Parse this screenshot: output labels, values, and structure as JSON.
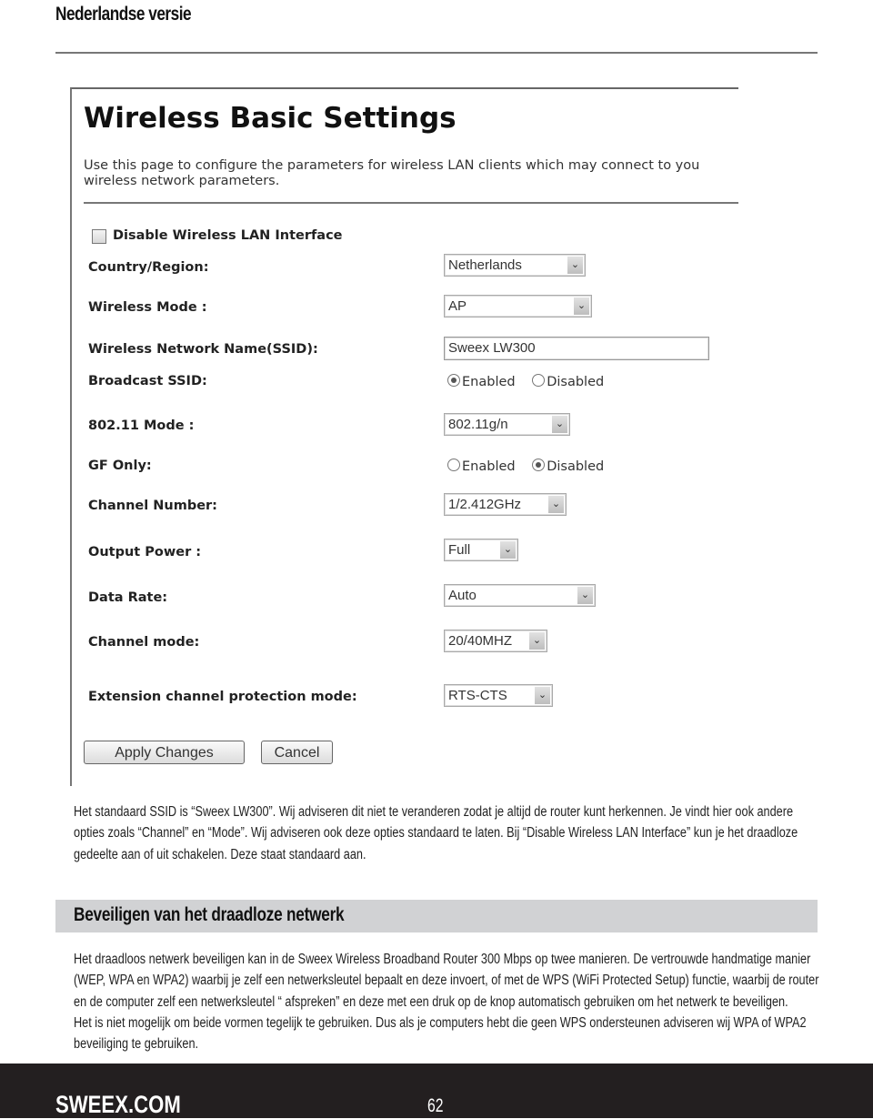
{
  "page": {
    "header": "Nederlandse versie",
    "footer_brand": "SWEEX.COM",
    "page_number": "62"
  },
  "screenshot": {
    "title": "Wireless Basic Settings",
    "description_line1": "Use this page to configure the parameters for wireless LAN clients which may connect to you",
    "description_line2": "wireless network parameters.",
    "disable_wlan": {
      "label": "Disable Wireless LAN Interface",
      "checked": false
    },
    "fields": {
      "country": {
        "label": "Country/Region:",
        "value": "Netherlands"
      },
      "wireless_mode": {
        "label": "Wireless Mode :",
        "value": "AP"
      },
      "ssid": {
        "label": "Wireless Network Name(SSID):",
        "value": "Sweex LW300"
      },
      "broadcast_ssid": {
        "label": "Broadcast SSID:",
        "options": [
          "Enabled",
          "Disabled"
        ],
        "selected": "Enabled"
      },
      "mode_80211": {
        "label": "802.11 Mode :",
        "value": "802.11g/n"
      },
      "gf_only": {
        "label": "GF Only:",
        "options": [
          "Enabled",
          "Disabled"
        ],
        "selected": "Disabled"
      },
      "channel_number": {
        "label": "Channel Number:",
        "value": "1/2.412GHz"
      },
      "output_power": {
        "label": "Output Power :",
        "value": "Full"
      },
      "data_rate": {
        "label": "Data Rate:",
        "value": "Auto"
      },
      "channel_mode": {
        "label": "Channel mode:",
        "value": "20/40MHZ"
      },
      "ext_protection": {
        "label": "Extension channel protection mode:",
        "value": "RTS-CTS"
      }
    },
    "buttons": {
      "apply": "Apply Changes",
      "cancel": "Cancel"
    }
  },
  "body": {
    "intro_lines": [
      "Het standaard SSID is “Sweex LW300”. Wij adviseren dit niet te veranderen zodat je altijd de router kunt herkennen. Je vindt hier ook andere",
      "opties zoals “Channel” en “Mode”. Wij adviseren ook deze opties standaard te laten. Bij “Disable Wireless LAN Interface” kun je het draadloze",
      "gedeelte aan of uit schakelen. Deze staat standaard aan."
    ],
    "section_title": "Beveiligen van het draadloze netwerk",
    "section_lines": [
      "Het draadloos netwerk beveiligen kan in de Sweex Wireless Broadband Router 300 Mbps op twee manieren. De vertrouwde handmatige manier",
      "(WEP, WPA en WPA2) waarbij je zelf een netwerksleutel bepaalt en deze invoert, of met de WPS (WiFi Protected Setup) functie, waarbij de router",
      "en de computer zelf een netwerksleutel “ afspreken”  en deze met een druk op de knop automatisch gebruiken om het netwerk te beveiligen.",
      "Het is niet mogelijk om beide vormen tegelijk te gebruiken. Dus als je computers hebt die geen WPS ondersteunen adviseren wij WPA of WPA2",
      "beveiliging te gebruiken."
    ]
  }
}
